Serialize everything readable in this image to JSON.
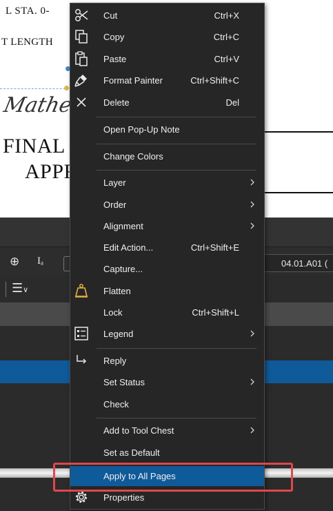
{
  "document": {
    "station_text": "L   STA. 0-",
    "length_text": "T LENGTH",
    "signature_text": "Mathew",
    "stamp_line1": "FINAL",
    "stamp_line2": "APPR"
  },
  "app": {
    "tab_label": "04.01.A01 ("
  },
  "context_menu": {
    "items": [
      {
        "label": "Cut",
        "shortcut": "Ctrl+X",
        "icon": "scissors-icon"
      },
      {
        "label": "Copy",
        "shortcut": "Ctrl+C",
        "icon": "copy-icon"
      },
      {
        "label": "Paste",
        "shortcut": "Ctrl+V",
        "icon": "paste-icon"
      },
      {
        "label": "Format Painter",
        "shortcut": "Ctrl+Shift+C",
        "icon": "format-painter-icon"
      },
      {
        "label": "Delete",
        "shortcut": "Del",
        "icon": "delete-x-icon"
      },
      {
        "label": "Open Pop-Up Note"
      },
      {
        "label": "Change Colors"
      },
      {
        "label": "Layer",
        "submenu": true
      },
      {
        "label": "Order",
        "submenu": true
      },
      {
        "label": "Alignment",
        "submenu": true
      },
      {
        "label": "Edit Action...",
        "shortcut": "Ctrl+Shift+E"
      },
      {
        "label": "Capture..."
      },
      {
        "label": "Flatten",
        "icon": "flatten-weight-icon"
      },
      {
        "label": "Lock",
        "shortcut": "Ctrl+Shift+L"
      },
      {
        "label": "Legend",
        "submenu": true,
        "icon": "legend-icon"
      },
      {
        "label": "Reply",
        "icon": "reply-arrow-icon"
      },
      {
        "label": "Set Status",
        "submenu": true
      },
      {
        "label": "Check"
      },
      {
        "label": "Add to Tool Chest",
        "submenu": true
      },
      {
        "label": "Set as Default"
      },
      {
        "label": "Apply to All Pages",
        "highlighted": true
      },
      {
        "label": "Properties",
        "icon": "gear-icon"
      }
    ]
  },
  "colors": {
    "menu_bg": "#262626",
    "highlight": "#0f5a99",
    "focus_frame": "#e0474c",
    "icon_accent": "#e8b13a"
  }
}
